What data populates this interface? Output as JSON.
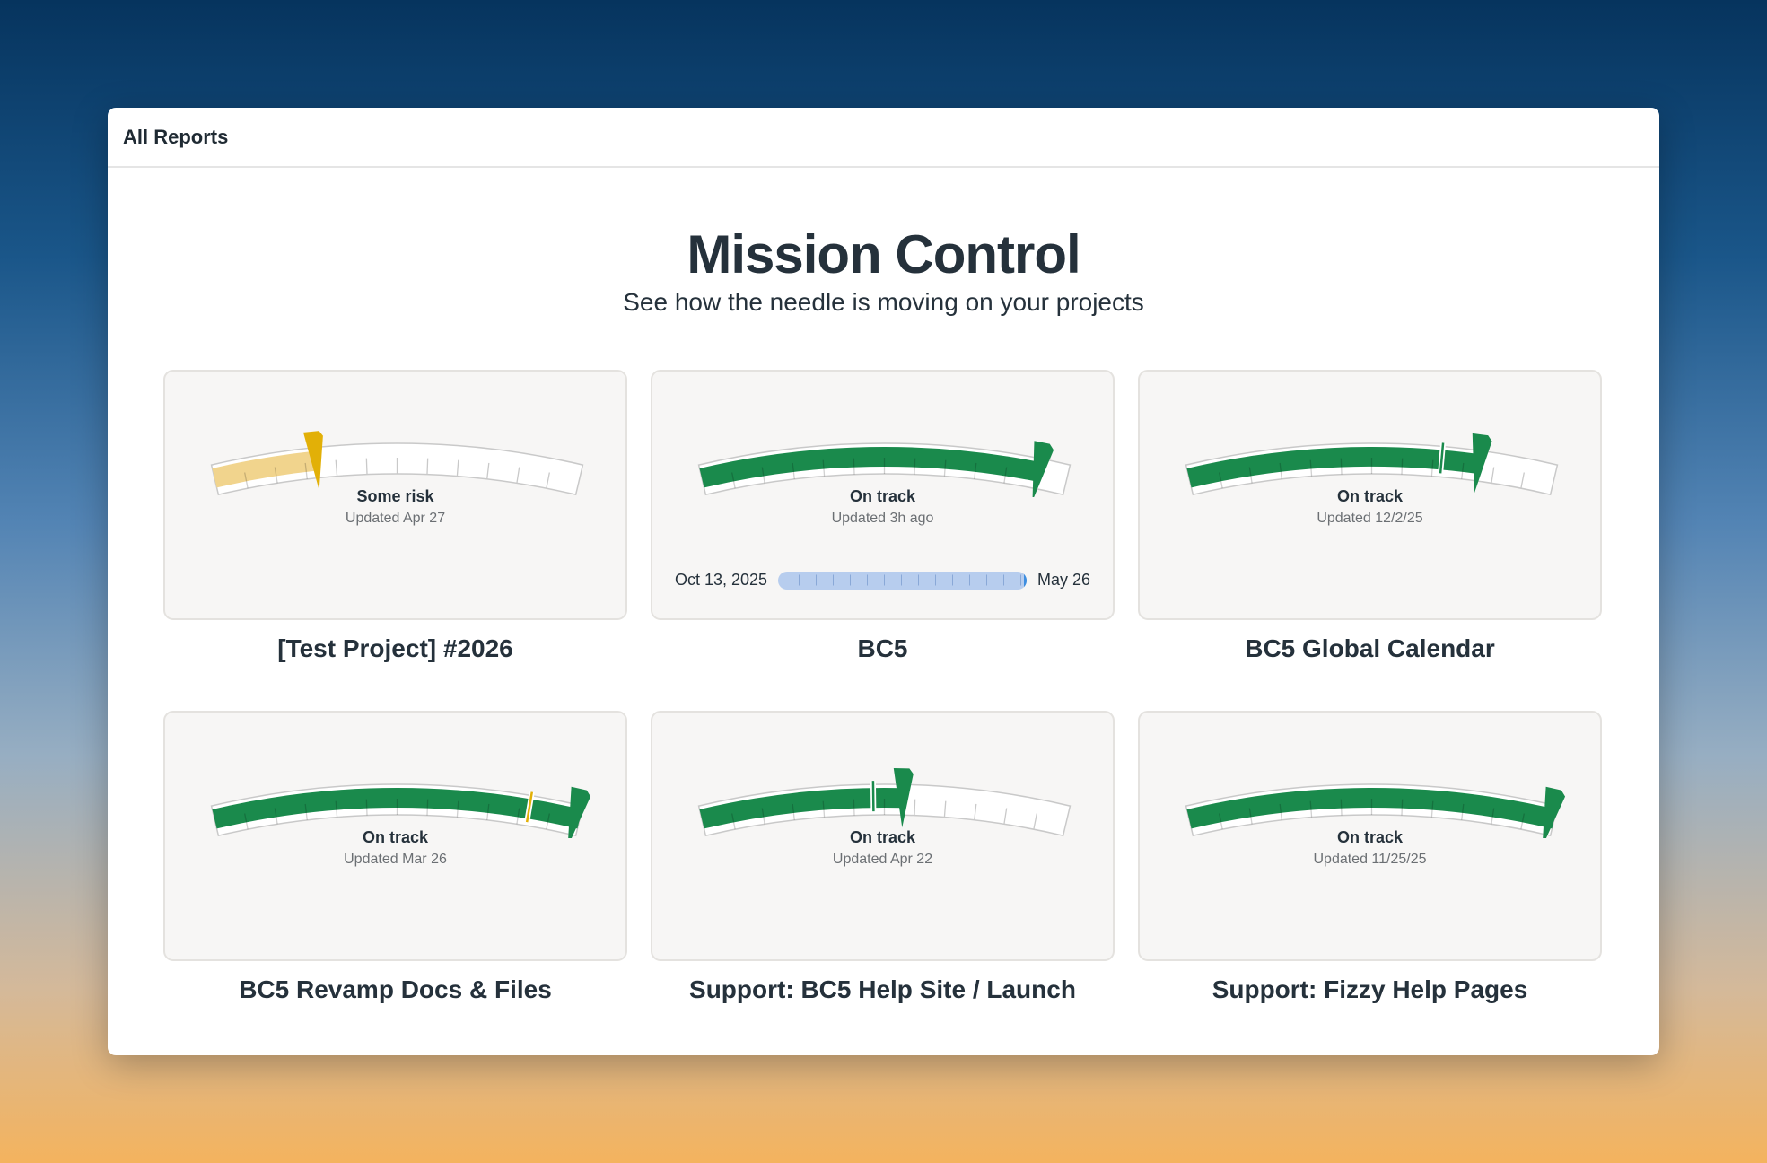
{
  "nav": {
    "all_reports": "All Reports"
  },
  "header": {
    "title": "Mission Control",
    "subtitle": "See how the needle is moving on your projects"
  },
  "colors": {
    "on_track": "#1a8a4c",
    "some_risk": "#e2b007",
    "some_risk_fill": "#f1d48d",
    "timeline": "#b7cdee",
    "timeline_marker": "#3e8ee0"
  },
  "projects": [
    {
      "title": "[Test Project] #2026",
      "status": "Some risk",
      "updated": "Updated Apr 27",
      "level": 0.28,
      "prior_level": null,
      "color": "some_risk",
      "timeline": null
    },
    {
      "title": "BC5",
      "status": "On track",
      "updated": "Updated 3h ago",
      "level": 0.92,
      "prior_level": null,
      "color": "on_track",
      "timeline": {
        "start": "Oct 13, 2025",
        "end": "May 26",
        "progress": 1.0
      }
    },
    {
      "title": "BC5 Global Calendar",
      "status": "On track",
      "updated": "Updated 12/2/25",
      "level": 0.79,
      "prior_level": 0.69,
      "color": "on_track",
      "timeline": null
    },
    {
      "title": "BC5 Revamp Docs & Files",
      "status": "On track",
      "updated": "Updated Mar 26",
      "level": 1.0,
      "prior_level": 0.86,
      "color": "on_track",
      "prior_color": "some_risk",
      "timeline": null
    },
    {
      "title": "Support: BC5 Help Site / Launch",
      "status": "On track",
      "updated": "Updated Apr 22",
      "level": 0.55,
      "prior_level": 0.47,
      "color": "on_track",
      "timeline": null
    },
    {
      "title": "Support: Fizzy Help Pages",
      "status": "On track",
      "updated": "Updated 11/25/25",
      "level": 1.0,
      "prior_level": null,
      "color": "on_track",
      "timeline": null
    }
  ]
}
